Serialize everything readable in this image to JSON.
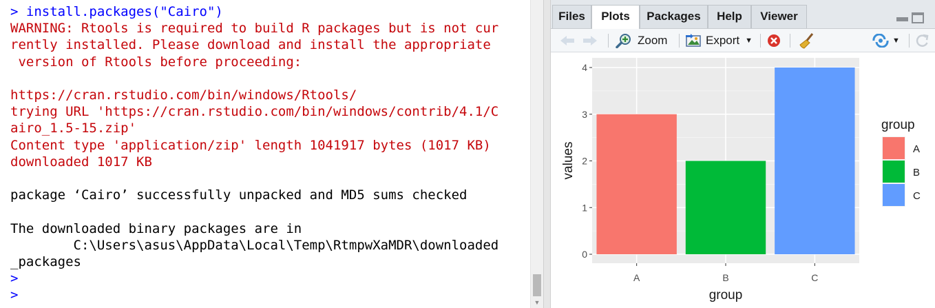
{
  "console": {
    "lines": [
      {
        "text": "> install.packages(\"Cairo\")",
        "color": "#0000ff"
      },
      {
        "text": "WARNING: Rtools is required to build R packages but is not cur",
        "color": "#c5060b"
      },
      {
        "text": "rently installed. Please download and install the appropriate",
        "color": "#c5060b"
      },
      {
        "text": " version of Rtools before proceeding:",
        "color": "#c5060b"
      },
      {
        "text": "",
        "color": "#c5060b"
      },
      {
        "text": "https://cran.rstudio.com/bin/windows/Rtools/",
        "color": "#c5060b"
      },
      {
        "text": "trying URL 'https://cran.rstudio.com/bin/windows/contrib/4.1/C",
        "color": "#c5060b"
      },
      {
        "text": "airo_1.5-15.zip'",
        "color": "#c5060b"
      },
      {
        "text": "Content type 'application/zip' length 1041917 bytes (1017 KB)",
        "color": "#c5060b"
      },
      {
        "text": "downloaded 1017 KB",
        "color": "#c5060b"
      },
      {
        "text": "",
        "color": "#000000"
      },
      {
        "text": "package ‘Cairo’ successfully unpacked and MD5 sums checked",
        "color": "#000000"
      },
      {
        "text": "",
        "color": "#000000"
      },
      {
        "text": "The downloaded binary packages are in",
        "color": "#000000"
      },
      {
        "text": "        C:\\Users\\asus\\AppData\\Local\\Temp\\RtmpwXaMDR\\downloaded",
        "color": "#000000"
      },
      {
        "text": "_packages",
        "color": "#000000"
      },
      {
        "text": ">",
        "color": "#0000ff"
      },
      {
        "text": ">",
        "color": "#0000ff"
      }
    ]
  },
  "viewer": {
    "tabs": [
      {
        "label": "Files",
        "active": false
      },
      {
        "label": "Plots",
        "active": true
      },
      {
        "label": "Packages",
        "active": false
      },
      {
        "label": "Help",
        "active": false
      },
      {
        "label": "Viewer",
        "active": false
      }
    ],
    "toolbar": {
      "zoom_label": "Zoom",
      "export_label": "Export",
      "icons": [
        "back-arrow-icon",
        "forward-arrow-icon",
        "zoom-icon",
        "export-icon",
        "remove-plot-icon",
        "broom-icon",
        "publish-icon",
        "refresh-icon"
      ]
    }
  },
  "chart_data": {
    "type": "bar",
    "categories": [
      "A",
      "B",
      "C"
    ],
    "values": [
      3,
      2,
      4
    ],
    "colors": [
      "#f8766d",
      "#00ba38",
      "#619cff"
    ],
    "xlabel": "group",
    "ylabel": "values",
    "yticks": [
      0,
      1,
      2,
      3,
      4
    ],
    "ylim": [
      0,
      4
    ],
    "grid": true,
    "panel_background": "#ebebeb",
    "legend": {
      "title": "group",
      "placement": "right",
      "entries": [
        "A",
        "B",
        "C"
      ]
    }
  }
}
